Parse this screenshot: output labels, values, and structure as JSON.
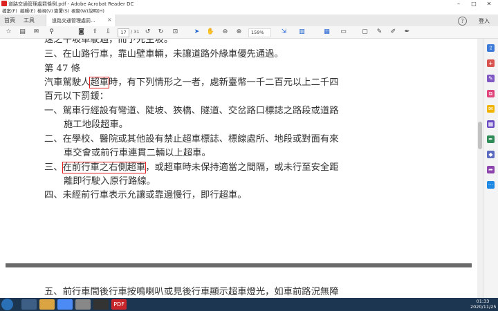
{
  "window": {
    "title": "道路交通管理處罰條例.pdf - Adobe Acrobat Reader DC",
    "minimize": "–",
    "maximize": "□",
    "close": "✕"
  },
  "menu": [
    "檔案(F)",
    "編輯(E)",
    "檢視(V)",
    "簽署(S)",
    "視窗(W)",
    "說明(H)"
  ],
  "tabs": {
    "home": "首頁",
    "tools": "工具",
    "doc": "道路交通管理處罰...",
    "doc_close": "×"
  },
  "header": {
    "help": "?",
    "login": "登入"
  },
  "toolbar": {
    "page_current": "17",
    "page_total": "/ 31",
    "zoom": "159%"
  },
  "document": {
    "lines": [
      {
        "text": "速之午坡車駛過，而予先生坡。"
      },
      {
        "text": "三、在山路行車，靠山壁車輛，未讓道路外緣車優先通過。"
      },
      {
        "text": "第 47 條"
      },
      {
        "pre": "汽車駕駛人",
        "hl": "超車",
        "post": "時，有下列情形之一者，處新臺幣一千二百元以上二千四"
      },
      {
        "text": "百元以下罰鍰："
      },
      {
        "text": "一、駕車行經設有彎道、陡坡、狹橋、隧道、交岔路口標誌之路段或道路"
      },
      {
        "text": "施工地段超車。"
      },
      {
        "text": "二、在學校、醫院或其他設有禁止超車標誌、標線處所、地段或對面有來"
      },
      {
        "text": "車交會或前行車連貫二輛以上超車。"
      },
      {
        "pre": "三、",
        "hl": "在前行車之右側超車",
        "post": "，或超車時未保持適當之間隔，或未行至安全距"
      },
      {
        "text": "離即行駛入原行路線。"
      },
      {
        "text": "四、未經前行車表示允讓或靠邊慢行，即行超車。"
      },
      {
        "text": "五、前行車間後行車按鳴喇叭或見後行車顯示超車燈光，如車前路況無障"
      }
    ]
  },
  "taskbar": {
    "apps": [
      "",
      "",
      "",
      "",
      "",
      "PDF"
    ],
    "time": "01:33",
    "date": "2020/11/25"
  }
}
